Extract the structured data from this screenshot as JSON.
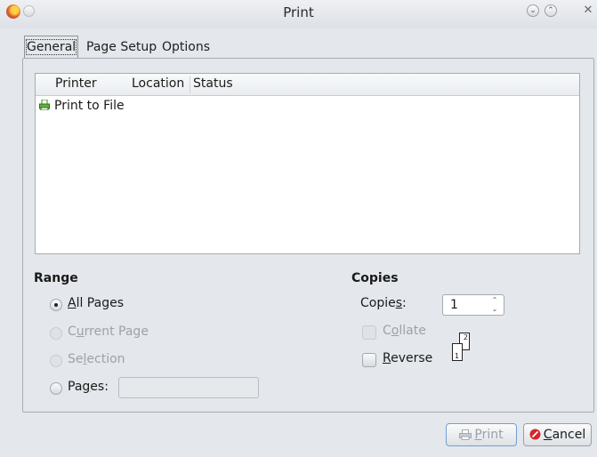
{
  "window": {
    "title": "Print"
  },
  "tabs": [
    {
      "label": "General",
      "active": true
    },
    {
      "label": "Page Setup",
      "active": false
    },
    {
      "label": "Options",
      "active": false
    }
  ],
  "printer_list": {
    "columns": [
      "Printer",
      "Location",
      "Status"
    ],
    "rows": [
      {
        "name": "Print to File",
        "icon": "printer-icon"
      }
    ]
  },
  "range": {
    "title": "Range",
    "options": [
      {
        "label_pre": "",
        "mnemonic": "A",
        "label_post": "ll Pages",
        "checked": true,
        "enabled": true
      },
      {
        "label_pre": "C",
        "mnemonic": "u",
        "label_post": "rrent Page",
        "checked": false,
        "enabled": false
      },
      {
        "label_pre": "Se",
        "mnemonic": "l",
        "label_post": "ection",
        "checked": false,
        "enabled": false
      },
      {
        "label_pre": "Pa",
        "mnemonic": "g",
        "label_post": "es:",
        "checked": false,
        "enabled": true
      }
    ],
    "pages_value": ""
  },
  "copies": {
    "title": "Copies",
    "label_pre": "Copie",
    "label_mnemonic": "s",
    "label_post": ":",
    "value": "1",
    "collate": {
      "label_pre": "C",
      "mnemonic": "o",
      "label_post": "llate",
      "checked": false,
      "enabled": false
    },
    "reverse": {
      "label_pre": "",
      "mnemonic": "R",
      "label_post": "everse",
      "checked": false,
      "enabled": true
    },
    "sheet_numbers": [
      "1",
      "2"
    ]
  },
  "buttons": {
    "print": {
      "mnemonic": "P",
      "label_post": "rint",
      "enabled": false,
      "icon": "printer-icon"
    },
    "cancel": {
      "mnemonic": "C",
      "label_post": "ancel",
      "icon": "cancel-icon"
    }
  },
  "colors": {
    "cancel_icon": "#d4262b",
    "focus_border": "#6fa1d6"
  }
}
